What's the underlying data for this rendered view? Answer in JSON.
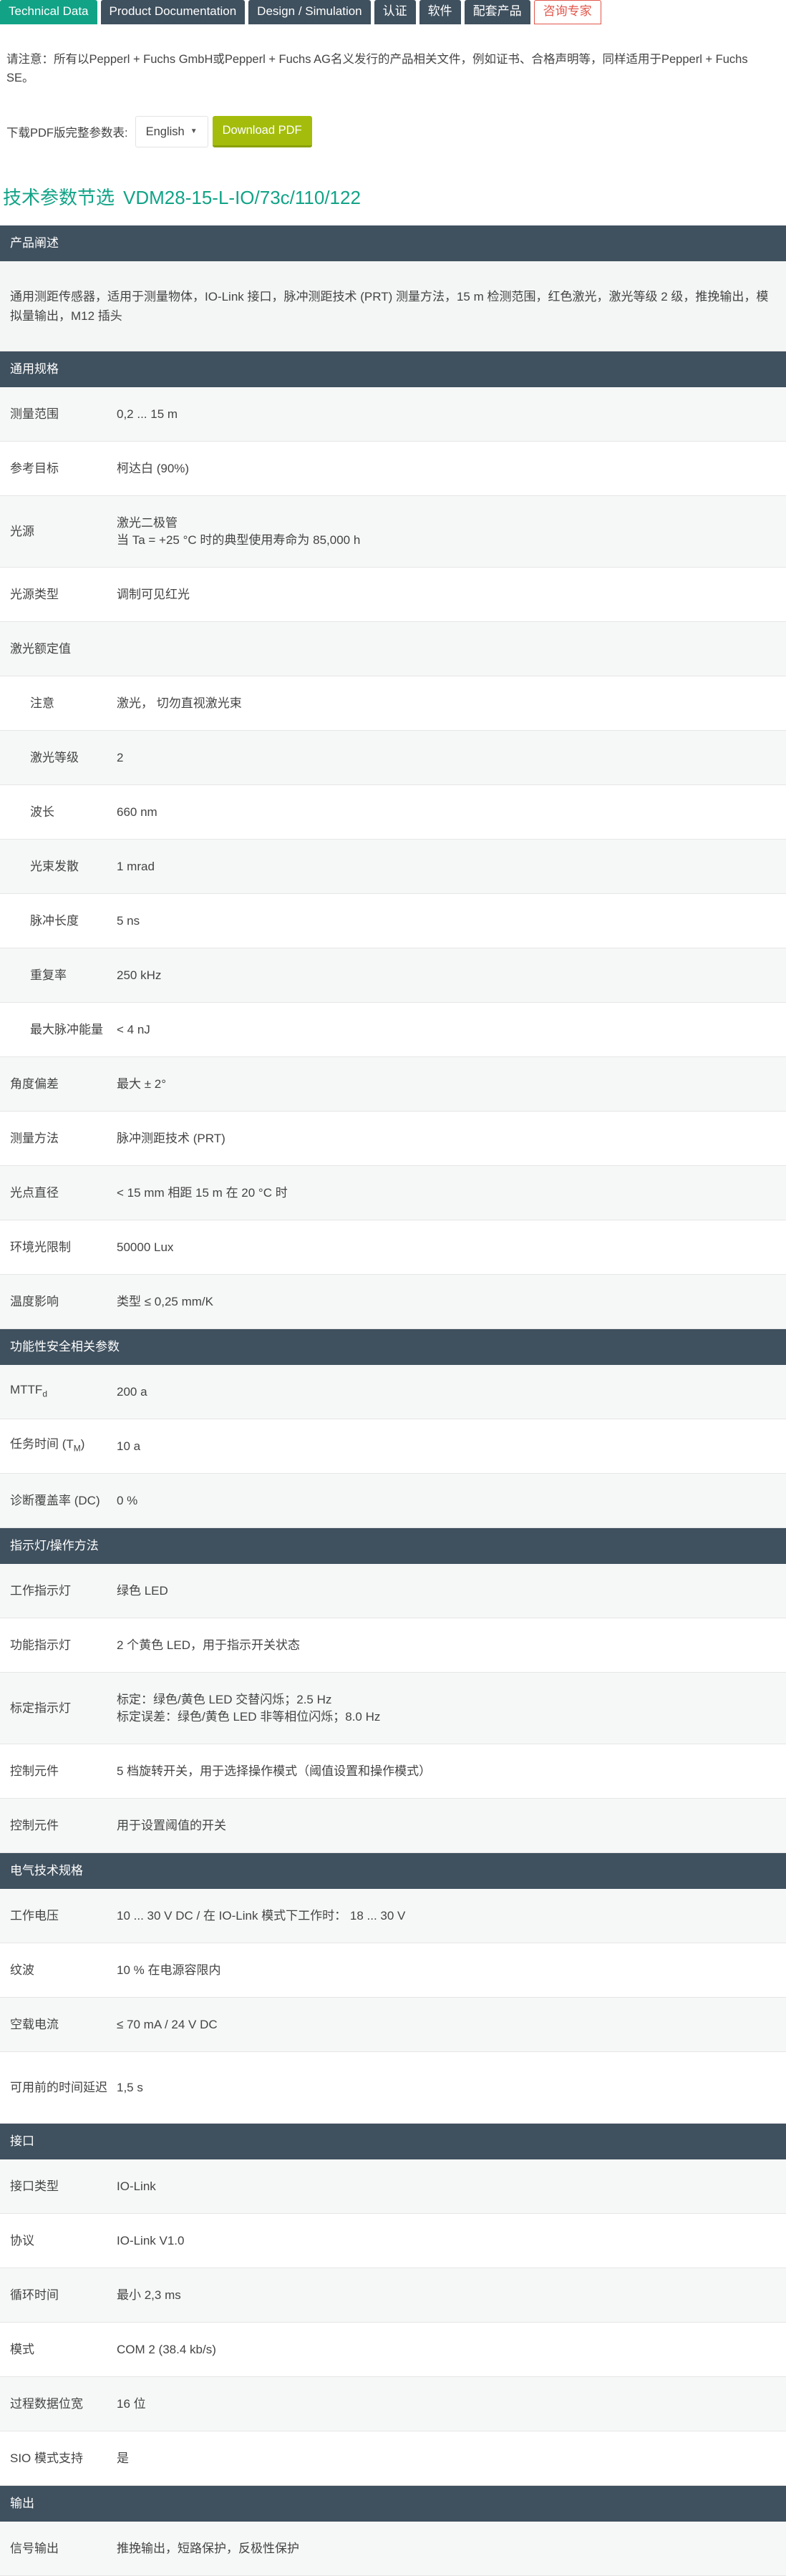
{
  "tabs": [
    "Technical Data",
    "Product Documentation",
    "Design / Simulation",
    "认证",
    "软件",
    "配套产品",
    "咨询专家"
  ],
  "notice": "请注意：所有以Pepperl + Fuchs GmbH或Pepperl + Fuchs AG名义发行的产品相关文件，例如证书、合格声明等，同样适用于Pepperl + Fuchs SE。",
  "download": {
    "label": "下载PDF版完整参数表:",
    "language": "English",
    "button": "Download PDF"
  },
  "title": {
    "prefix": "技术参数节选",
    "model": "VDM28-15-L-IO/73c/110/122"
  },
  "icons": {
    "language_caret": "chevron-down-icon"
  },
  "colors": {
    "tab_active": "#12a387",
    "header": "#3f505e",
    "download_button": "#a4bd0c",
    "expert_tab": "#e2564a"
  },
  "sections": [
    {
      "title": "产品阐述",
      "description": "通用测距传感器，适用于测量物体，IO-Link 接口，脉冲测距技术 (PRT) 测量方法，15 m 检测范围，红色激光，激光等级 2 级，推挽输出，模拟量输出，M12 插头"
    },
    {
      "title": "通用规格",
      "rows": [
        {
          "k": "测量范围",
          "v": "0,2 ... 15 m"
        },
        {
          "k": "参考目标",
          "v": "柯达白 (90%)"
        },
        {
          "k": "光源",
          "v": "激光二极管",
          "v2": "当 Ta = +25 °C 时的典型使用寿命为 85,000 h"
        },
        {
          "k": "光源类型",
          "v": "调制可见红光"
        },
        {
          "k": "激光额定值",
          "v": ""
        },
        {
          "k": "注意",
          "v": "激光， 切勿直视激光束",
          "sub": true
        },
        {
          "k": "激光等级",
          "v": "2",
          "sub": true
        },
        {
          "k": "波长",
          "v": "660 nm",
          "sub": true
        },
        {
          "k": "光束发散",
          "v": "1 mrad",
          "sub": true
        },
        {
          "k": "脉冲长度",
          "v": "5 ns",
          "sub": true
        },
        {
          "k": "重复率",
          "v": "250 kHz",
          "sub": true
        },
        {
          "k": "最大脉冲能量",
          "v": "< 4 nJ",
          "sub": true
        },
        {
          "k": "角度偏差",
          "v": "最大 ± 2°"
        },
        {
          "k": "测量方法",
          "v": "脉冲测距技术 (PRT)"
        },
        {
          "k": "光点直径",
          "v": "< 15 mm 相距 15 m 在 20 °C 时"
        },
        {
          "k": "环境光限制",
          "v": "50000 Lux"
        },
        {
          "k": "温度影响",
          "v": "类型 ≤ 0,25 mm/K"
        }
      ]
    },
    {
      "title": "功能性安全相关参数",
      "rows": [
        {
          "k": "MTTF",
          "ksub": "d",
          "v": "200 a"
        },
        {
          "k": "任务时间 (T",
          "ksub": "M",
          "kend": ")",
          "v": "10 a"
        },
        {
          "k": "诊断覆盖率 (DC)",
          "v": "0 %"
        }
      ]
    },
    {
      "title": "指示灯/操作方法",
      "rows": [
        {
          "k": "工作指示灯",
          "v": "绿色 LED"
        },
        {
          "k": "功能指示灯",
          "v": "2 个黄色 LED，用于指示开关状态"
        },
        {
          "k": "标定指示灯",
          "v": "标定：绿色/黄色 LED 交替闪烁；2.5 Hz",
          "v2": "标定误差：绿色/黄色 LED 非等相位闪烁；8.0 Hz"
        },
        {
          "k": "控制元件",
          "v": "5 档旋转开关，用于选择操作模式（阈值设置和操作模式）"
        },
        {
          "k": "控制元件",
          "v": "用于设置阈值的开关"
        }
      ]
    },
    {
      "title": "电气技术规格",
      "rows": [
        {
          "k": "工作电压",
          "v": "10 ... 30 V DC / 在 IO-Link 模式下工作时： 18 ... 30 V"
        },
        {
          "k": "纹波",
          "v": "10 % 在电源容限内"
        },
        {
          "k": "空载电流",
          "v": "≤ 70 mA / 24 V DC"
        },
        {
          "k": "可用前的时间延迟",
          "v": "1,5 s"
        }
      ]
    },
    {
      "title": "接口",
      "rows": [
        {
          "k": "接口类型",
          "v": "IO-Link"
        },
        {
          "k": "协议",
          "v": "IO-Link V1.0"
        },
        {
          "k": "循环时间",
          "v": "最小 2,3 ms"
        },
        {
          "k": "模式",
          "v": "COM 2 (38.4 kb/s)"
        },
        {
          "k": "过程数据位宽",
          "v": "16 位"
        },
        {
          "k": "SIO 模式支持",
          "v": "是"
        }
      ]
    },
    {
      "title": "输出",
      "rows": [
        {
          "k": "信号输出",
          "v": "推挽输出，短路保护，反极性保护"
        }
      ]
    }
  ]
}
